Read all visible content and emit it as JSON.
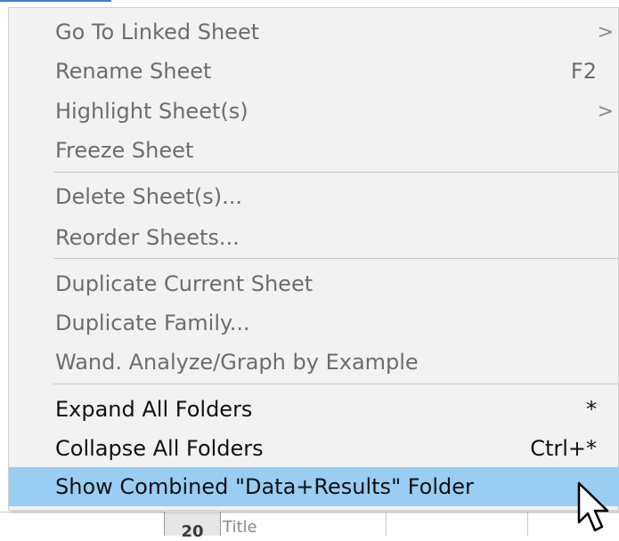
{
  "menu": {
    "items": [
      {
        "label": "Go To Linked Sheet",
        "shortcut": "",
        "submenu": true,
        "enabled": false
      },
      {
        "label": "Rename Sheet",
        "shortcut": "F2",
        "submenu": false,
        "enabled": false
      },
      {
        "label": "Highlight Sheet(s)",
        "shortcut": "",
        "submenu": true,
        "enabled": false
      },
      {
        "label": "Freeze Sheet",
        "shortcut": "",
        "submenu": false,
        "enabled": false
      },
      {
        "label": "Delete Sheet(s)...",
        "shortcut": "",
        "submenu": false,
        "enabled": false
      },
      {
        "label": "Reorder Sheets...",
        "shortcut": "",
        "submenu": false,
        "enabled": false
      },
      {
        "label": "Duplicate Current Sheet",
        "shortcut": "",
        "submenu": false,
        "enabled": false
      },
      {
        "label": "Duplicate Family...",
        "shortcut": "",
        "submenu": false,
        "enabled": false
      },
      {
        "label": "Wand. Analyze/Graph by Example",
        "shortcut": "",
        "submenu": false,
        "enabled": false
      },
      {
        "label": "Expand All Folders",
        "shortcut": "*",
        "submenu": false,
        "enabled": true
      },
      {
        "label": "Collapse All Folders",
        "shortcut": "Ctrl+*",
        "submenu": false,
        "enabled": true
      },
      {
        "label": "Show Combined \"Data+Results\" Folder",
        "shortcut": "",
        "submenu": false,
        "enabled": true,
        "selected": true
      }
    ],
    "submenu_glyph": ">"
  },
  "background": {
    "row_number": "20",
    "cell_text": "Title"
  },
  "colors": {
    "menu_bg": "#f2f2f2",
    "selected_bg": "#99cdf2",
    "disabled_text": "#6d6d6d",
    "enabled_text": "#111111"
  }
}
